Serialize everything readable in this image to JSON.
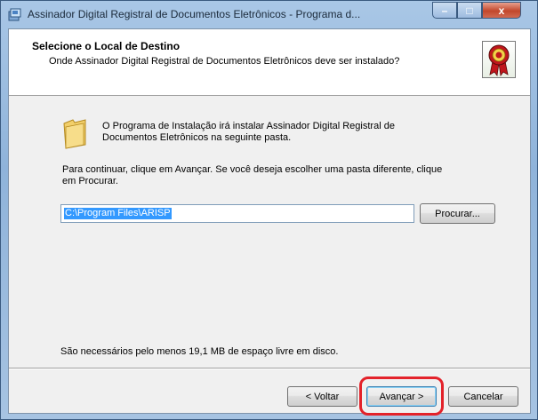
{
  "window": {
    "title": "Assinador Digital Registral de Documentos Eletrônicos - Programa d...",
    "controls": {
      "minimize": "–",
      "maximize": "□",
      "close": "x"
    }
  },
  "header": {
    "title": "Selecione o Local de Destino",
    "subtitle": "Onde Assinador Digital Registral de Documentos Eletrônicos deve ser instalado?"
  },
  "body": {
    "intro_line1": "O Programa de Instalação irá instalar Assinador Digital Registral de",
    "intro_line2": "Documentos Eletrônicos na seguinte pasta.",
    "continue_line1": "Para continuar, clique em Avançar. Se você deseja escolher uma pasta diferente, clique",
    "continue_line2": "em Procurar.",
    "path_value": "C:\\Program Files\\ARISP",
    "browse_label": "Procurar...",
    "space_text": "São necessários pelo menos 19,1 MB de espaço livre em disco."
  },
  "footer": {
    "back_label": "< Voltar",
    "next_label": "Avançar >",
    "cancel_label": "Cancelar"
  },
  "colors": {
    "selection": "#3399ff",
    "highlight_ring": "#e3222a",
    "badge_red": "#c0161c",
    "folder_yellow": "#f2cf6a"
  }
}
